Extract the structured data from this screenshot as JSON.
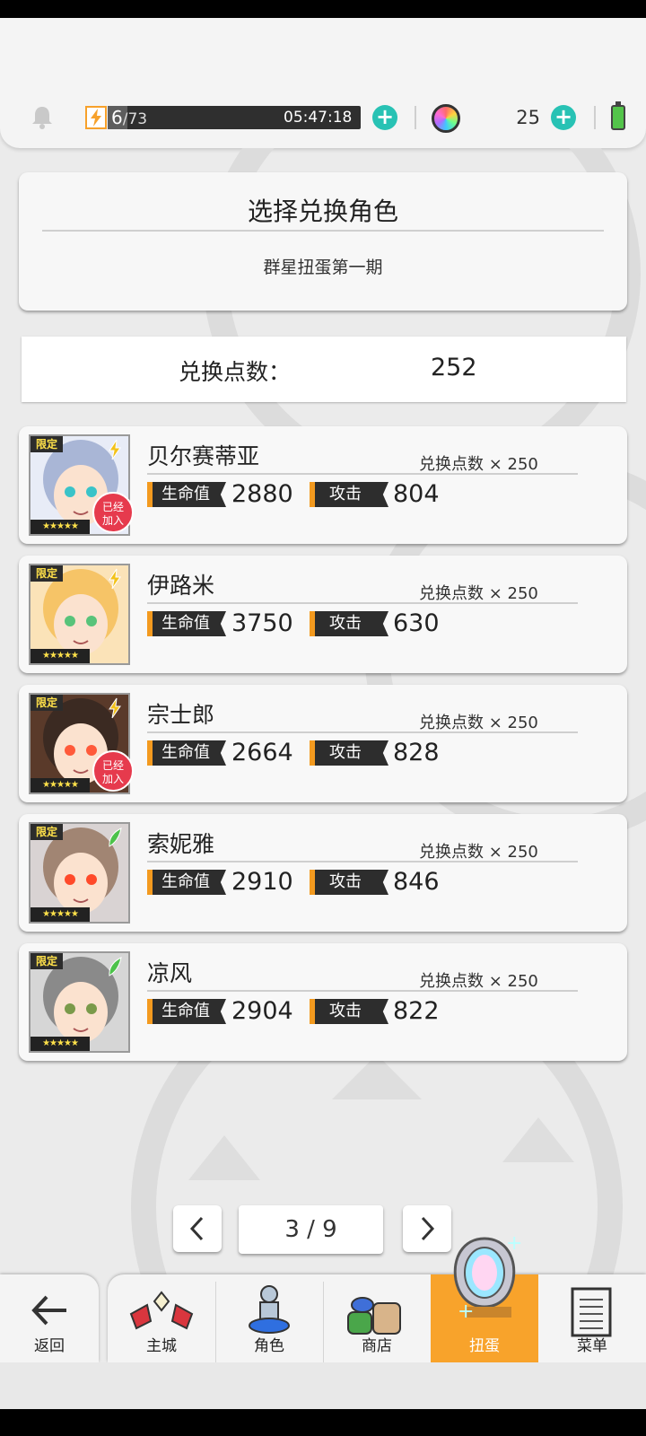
{
  "header": {
    "stamina_current": "6",
    "stamina_max": "/73",
    "stamina_timer": "05:47:18",
    "gem_count": "25"
  },
  "title_card": {
    "title": "选择兑换角色",
    "subtitle": "群星扭蛋第一期"
  },
  "points": {
    "label": "兑换点数：",
    "value": "252"
  },
  "labels": {
    "limited": "限定",
    "hp": "生命值",
    "atk": "攻击",
    "joined": "已经加入",
    "stars": "★★★★★"
  },
  "characters": [
    {
      "name": "贝尔赛蒂亚",
      "cost": "兑换点数 × 250",
      "hp": "2880",
      "atk": "804",
      "joined": true,
      "type": "lightning"
    },
    {
      "name": "伊路米",
      "cost": "兑换点数 × 250",
      "hp": "3750",
      "atk": "630",
      "joined": false,
      "type": "lightning"
    },
    {
      "name": "宗士郎",
      "cost": "兑换点数 × 250",
      "hp": "2664",
      "atk": "828",
      "joined": true,
      "type": "lightning"
    },
    {
      "name": "索妮雅",
      "cost": "兑换点数 × 250",
      "hp": "2910",
      "atk": "846",
      "joined": false,
      "type": "wind"
    },
    {
      "name": "凉风",
      "cost": "兑换点数 × 250",
      "hp": "2904",
      "atk": "822",
      "joined": false,
      "type": "wind"
    }
  ],
  "pager": {
    "label": "3 / 9"
  },
  "nav": {
    "back": "返回",
    "tabs": [
      "主城",
      "角色",
      "商店",
      "扭蛋",
      "菜单"
    ],
    "active": "扭蛋"
  },
  "colors": {
    "accent_teal": "#28c2b4",
    "accent_orange": "#f8a32b",
    "badge_red": "#e63a4d"
  }
}
